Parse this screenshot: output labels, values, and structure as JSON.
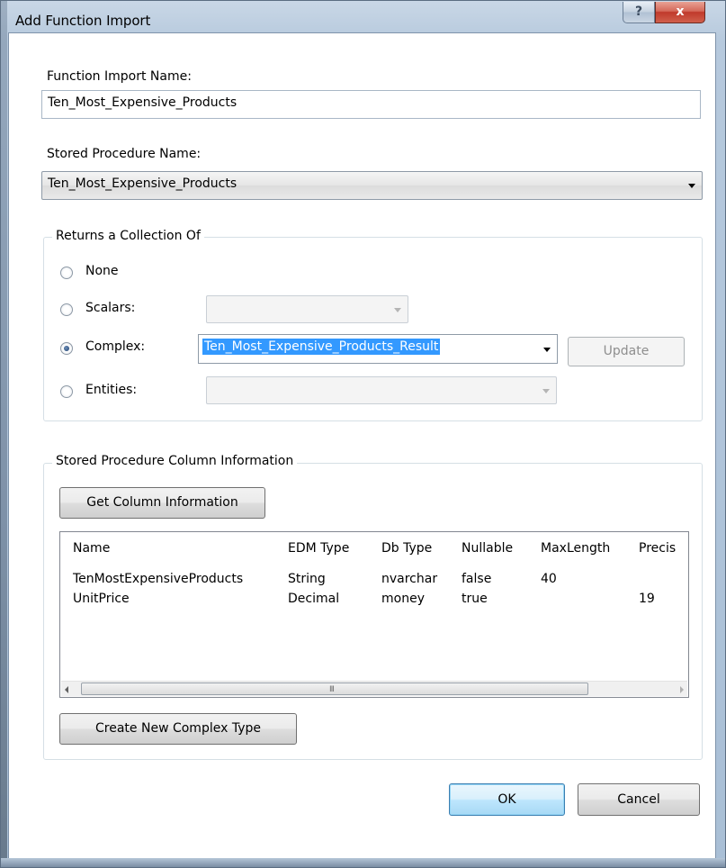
{
  "window": {
    "title": "Add Function Import",
    "help_glyph": "?",
    "close_glyph": "x"
  },
  "function_import": {
    "label": "Function Import Name:",
    "value": "Ten_Most_Expensive_Products"
  },
  "stored_procedure": {
    "label": "Stored Procedure Name:",
    "value": "Ten_Most_Expensive_Products"
  },
  "returns": {
    "title": "Returns a Collection Of",
    "options": [
      {
        "label": "None",
        "checked": false
      },
      {
        "label": "Scalars:",
        "checked": false
      },
      {
        "label": "Complex:",
        "checked": true
      },
      {
        "label": "Entities:",
        "checked": false
      }
    ],
    "complex_value": "Ten_Most_Expensive_Products_Result",
    "update_label": "Update"
  },
  "columns_group": {
    "title": "Stored Procedure Column Information",
    "get_button": "Get Column Information",
    "headers": [
      "Name",
      "EDM Type",
      "Db Type",
      "Nullable",
      "MaxLength",
      "Precis"
    ],
    "rows": [
      [
        "TenMostExpensiveProducts",
        "String",
        "nvarchar",
        "false",
        "40",
        ""
      ],
      [
        "UnitPrice",
        "Decimal",
        "money",
        "true",
        "",
        "19"
      ]
    ],
    "scroll_grip": "III",
    "create_button": "Create New Complex Type"
  },
  "buttons": {
    "ok": "OK",
    "cancel": "Cancel"
  }
}
